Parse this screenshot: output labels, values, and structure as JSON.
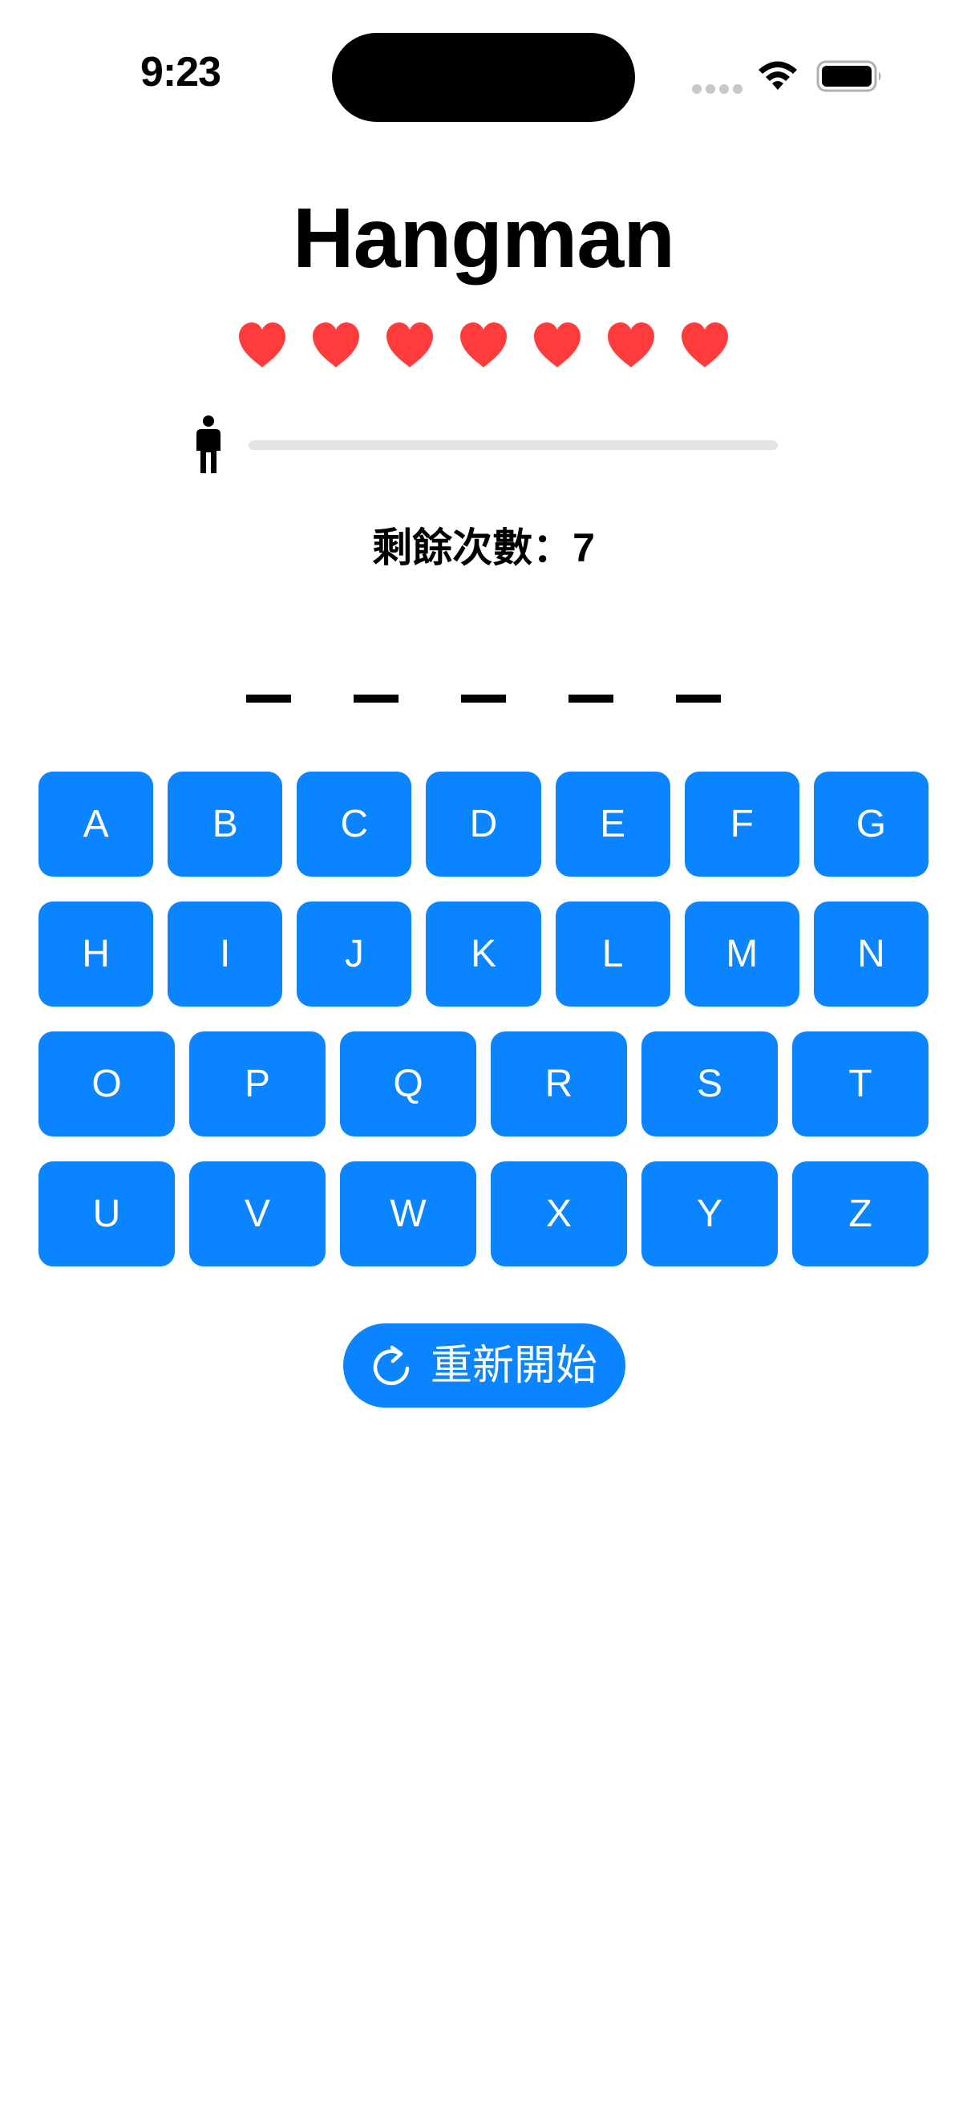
{
  "status_bar": {
    "time": "9:23"
  },
  "app": {
    "title": "Hangman",
    "lives_total": 7,
    "lives_remaining": 7,
    "progress_fraction": 0,
    "remaining_text": "剩餘次數：7",
    "word_slots": [
      "",
      "",
      "",
      "",
      ""
    ],
    "keyboard_rows": [
      [
        "A",
        "B",
        "C",
        "D",
        "E",
        "F",
        "G"
      ],
      [
        "H",
        "I",
        "J",
        "K",
        "L",
        "M",
        "N"
      ],
      [
        "O",
        "P",
        "Q",
        "R",
        "S",
        "T"
      ],
      [
        "U",
        "V",
        "W",
        "X",
        "Y",
        "Z"
      ]
    ],
    "restart_label": "重新開始",
    "restart_icon": "arrow-clockwise-icon",
    "heart_icon": "heart-icon",
    "person_icon": "person-icon"
  },
  "colors": {
    "accent": "#0a84ff",
    "heart": "#ff3b3b",
    "text": "#000000",
    "track": "#e3e3e6"
  }
}
